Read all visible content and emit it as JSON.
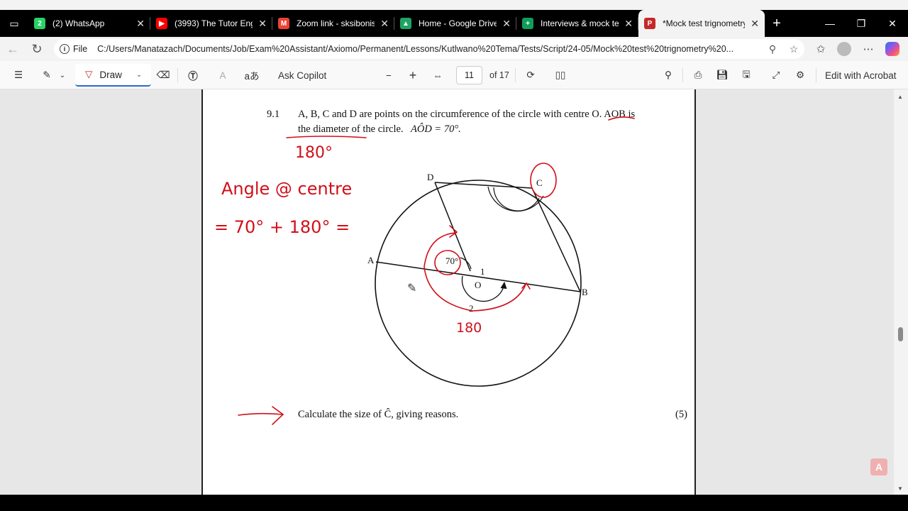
{
  "tabs": [
    {
      "title": "(2) WhatsApp",
      "icon": "whatsapp-icon",
      "color": "#25D366",
      "glyph": "2"
    },
    {
      "title": "(3993) The Tutor Engine",
      "icon": "youtube-icon",
      "color": "#ff0000",
      "glyph": "▶"
    },
    {
      "title": "Zoom link - sksibonisol",
      "icon": "gmail-icon",
      "color": "#ea4335",
      "glyph": "M"
    },
    {
      "title": "Home - Google Drive",
      "icon": "google-drive-icon",
      "color": "#1fa463",
      "glyph": "▲"
    },
    {
      "title": "Interviews & mock tes",
      "icon": "google-sheets-icon",
      "color": "#0f9d58",
      "glyph": "+"
    },
    {
      "title": "*Mock test trignometry",
      "icon": "pdf-icon",
      "color": "#c62828",
      "glyph": "P"
    }
  ],
  "address": {
    "label": "File",
    "url": "C:/Users/Manatazach/Documents/Job/Exam%20Assistant/Axiomo/Permanent/Lessons/Kutlwano%20Tema/Tests/Script/24-05/Mock%20test%20trignometry%20..."
  },
  "pdf_toolbar": {
    "draw_label": "Draw",
    "ask_copilot": "Ask Copilot",
    "page_current": "11",
    "page_total": "of 17",
    "edit_acrobat": "Edit with Acrobat"
  },
  "document": {
    "question_number": "9.1",
    "line1": "A, B, C and D are points on the circumference of the circle with centre O. AOB is",
    "line2": "the diameter of the circle.",
    "given": "AÔD = 70°.",
    "point_labels": {
      "A": "A",
      "B": "B",
      "C": "C",
      "D": "D",
      "O": "O"
    },
    "angle_70": "70°",
    "angle_1": "1",
    "angle_2": "2",
    "task": "Calculate the size of Ĉ, giving reasons.",
    "marks": "(5)"
  },
  "annotations": {
    "ink_color": "#d0101a",
    "under_diameter": "180°",
    "angle_center": "Angle @ centre",
    "equation": "= 70° + 180° =",
    "below_circle": "180"
  }
}
